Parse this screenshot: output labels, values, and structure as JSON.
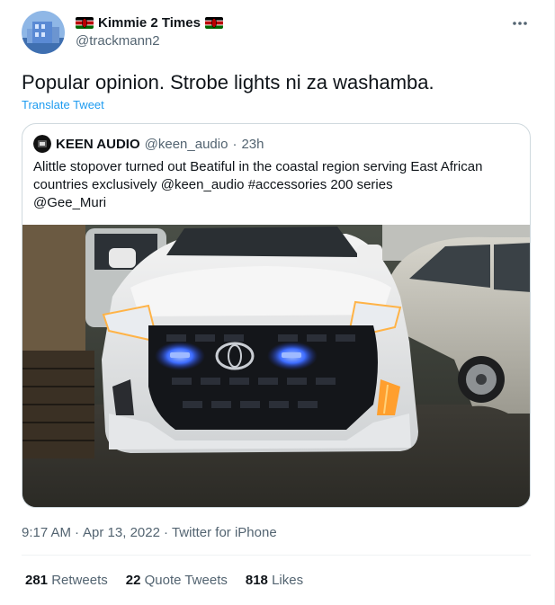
{
  "author": {
    "name": "Kimmie 2 Times",
    "handle": "@trackmann2"
  },
  "tweet": {
    "text": "Popular opinion. Strobe lights ni za washamba.",
    "translate_label": "Translate Tweet",
    "time": "9:17 AM",
    "date": "Apr 13, 2022",
    "source": "Twitter for iPhone",
    "separator": "·"
  },
  "quote": {
    "name": "KEEN AUDIO",
    "handle": "@keen_audio",
    "age": "23h",
    "separator": "·",
    "text_lines": [
      "Alittle stopover turned out Beatiful in the coastal region serving East African",
      "countries exclusively @keen_audio #accessories 200 series",
      "@Gee_Muri"
    ]
  },
  "stats": [
    {
      "count": "281",
      "label": "Retweets"
    },
    {
      "count": "22",
      "label": "Quote Tweets"
    },
    {
      "count": "818",
      "label": "Likes"
    }
  ],
  "colors": {
    "link": "#1d9bf0",
    "secondary_text": "#536471",
    "border": "#cfd9de"
  },
  "icons": [
    "more-icon",
    "kenya-flag-icon"
  ]
}
